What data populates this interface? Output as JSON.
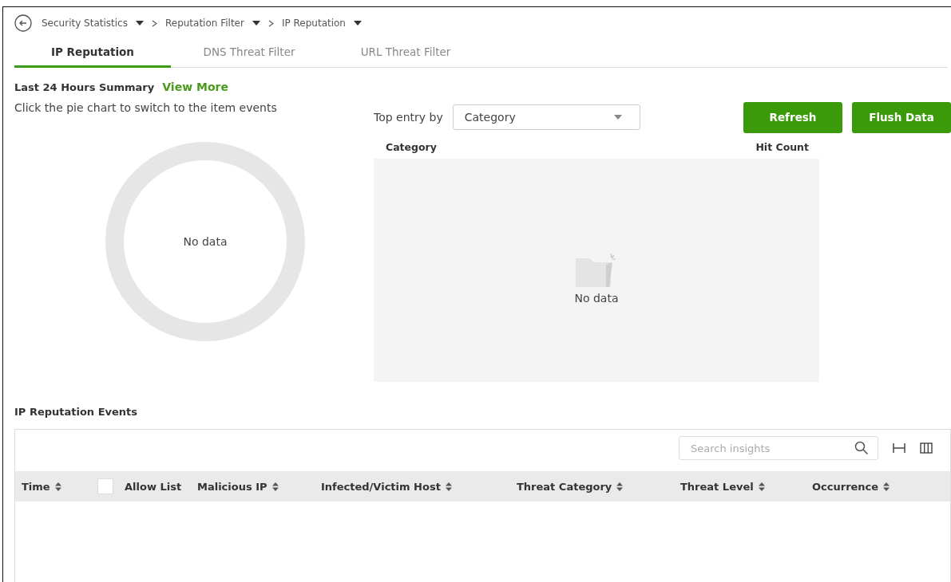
{
  "breadcrumb": [
    {
      "label": "Security Statistics"
    },
    {
      "label": "Reputation Filter"
    },
    {
      "label": "IP Reputation"
    }
  ],
  "tabs": [
    {
      "label": "IP Reputation",
      "selected": true
    },
    {
      "label": "DNS Threat Filter",
      "selected": false
    },
    {
      "label": "URL Threat Filter",
      "selected": false
    }
  ],
  "summary": {
    "title": "Last 24 Hours Summary",
    "link": "View More",
    "hint": "Click the pie chart to switch to the item events",
    "donut_empty_text": "No data"
  },
  "top_entry": {
    "label": "Top entry by",
    "value": "Category"
  },
  "buttons": [
    "Refresh",
    "Flush Data"
  ],
  "top_table": {
    "columns": [
      "Category",
      "Hit Count"
    ],
    "empty_text": "No data"
  },
  "events": {
    "title": "IP Reputation Events",
    "search": {
      "placeholder": "Search insights"
    },
    "columns": [
      {
        "label": "Time",
        "kind": "sortable"
      },
      {
        "label": "Allow List",
        "kind": "checkbox",
        "checked": false
      },
      {
        "label": "Malicious IP",
        "kind": "sortable"
      },
      {
        "label": "Infected/Victim Host",
        "kind": "sortable"
      },
      {
        "label": "Threat Category",
        "kind": "sortable"
      },
      {
        "label": "Threat Level",
        "kind": "sortable"
      },
      {
        "label": "Occurrence",
        "kind": "sortable"
      }
    ]
  }
}
